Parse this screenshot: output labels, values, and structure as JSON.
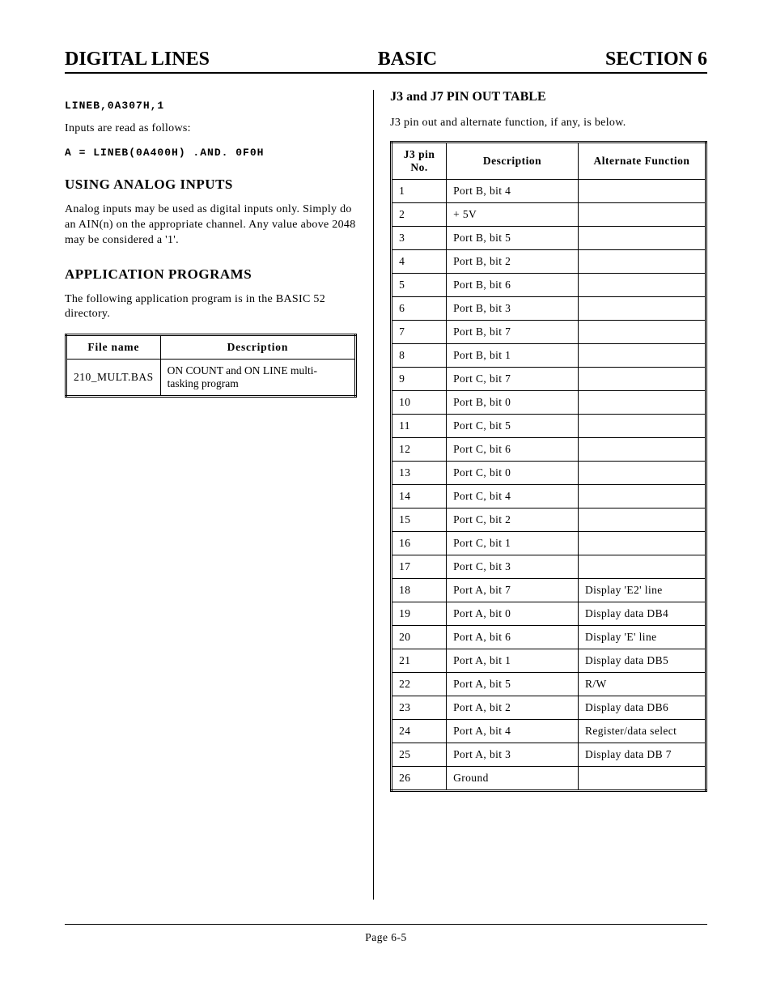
{
  "header": {
    "left": "DIGITAL LINES",
    "center": "BASIC",
    "right": "SECTION 6"
  },
  "left": {
    "code1": "LINEB,0A307H,1",
    "p1": "Inputs are read as follows:",
    "code2": "A = LINEB(0A400H) .AND. 0F0H",
    "h1": "USING ANALOG INPUTS",
    "p2": "Analog inputs may be used as digital inputs only.  Simply do an AIN(n) on the appropriate channel.  Any value above 2048 may be considered a '1'.",
    "h2": "APPLICATION PROGRAMS",
    "p3": "The following application program is in the BASIC 52 directory.",
    "prog_headers": {
      "c1": "File name",
      "c2": "Description"
    },
    "prog_rows": [
      {
        "file": "210_MULT.BAS",
        "desc": "ON COUNT and ON LINE multi-tasking program"
      }
    ]
  },
  "right": {
    "h1": "J3 and J7 PIN OUT TABLE",
    "p1": "J3 pin out and alternate function, if any, is below.",
    "pin_headers": {
      "c1": "J3 pin No.",
      "c2": "Description",
      "c3": "Alternate Function"
    },
    "pin_rows": [
      {
        "no": "1",
        "desc": "Port B, bit 4",
        "alt": ""
      },
      {
        "no": "2",
        "desc": "+ 5V",
        "alt": ""
      },
      {
        "no": "3",
        "desc": "Port B, bit 5",
        "alt": ""
      },
      {
        "no": "4",
        "desc": "Port B, bit 2",
        "alt": ""
      },
      {
        "no": "5",
        "desc": "Port B, bit 6",
        "alt": ""
      },
      {
        "no": "6",
        "desc": "Port B, bit 3",
        "alt": ""
      },
      {
        "no": "7",
        "desc": "Port B, bit 7",
        "alt": ""
      },
      {
        "no": "8",
        "desc": "Port B, bit 1",
        "alt": ""
      },
      {
        "no": "9",
        "desc": "Port C, bit 7",
        "alt": ""
      },
      {
        "no": "10",
        "desc": "Port B, bit 0",
        "alt": ""
      },
      {
        "no": "11",
        "desc": "Port C, bit 5",
        "alt": ""
      },
      {
        "no": "12",
        "desc": "Port C, bit 6",
        "alt": ""
      },
      {
        "no": "13",
        "desc": "Port C, bit 0",
        "alt": ""
      },
      {
        "no": "14",
        "desc": "Port C, bit 4",
        "alt": ""
      },
      {
        "no": "15",
        "desc": "Port C, bit 2",
        "alt": ""
      },
      {
        "no": "16",
        "desc": "Port C, bit 1",
        "alt": ""
      },
      {
        "no": "17",
        "desc": "Port C, bit 3",
        "alt": ""
      },
      {
        "no": "18",
        "desc": "Port A, bit 7",
        "alt": "Display 'E2' line"
      },
      {
        "no": "19",
        "desc": "Port A, bit 0",
        "alt": "Display data DB4"
      },
      {
        "no": "20",
        "desc": "Port A, bit 6",
        "alt": "Display 'E' line"
      },
      {
        "no": "21",
        "desc": "Port A, bit 1",
        "alt": "Display data DB5"
      },
      {
        "no": "22",
        "desc": "Port A, bit 5",
        "alt": "R/W"
      },
      {
        "no": "23",
        "desc": "Port A, bit 2",
        "alt": "Display data DB6"
      },
      {
        "no": "24",
        "desc": "Port A, bit 4",
        "alt": "Register/data select"
      },
      {
        "no": "25",
        "desc": "Port A, bit 3",
        "alt": "Display data DB 7"
      },
      {
        "no": "26",
        "desc": "Ground",
        "alt": ""
      }
    ]
  },
  "footer": "Page 6-5"
}
